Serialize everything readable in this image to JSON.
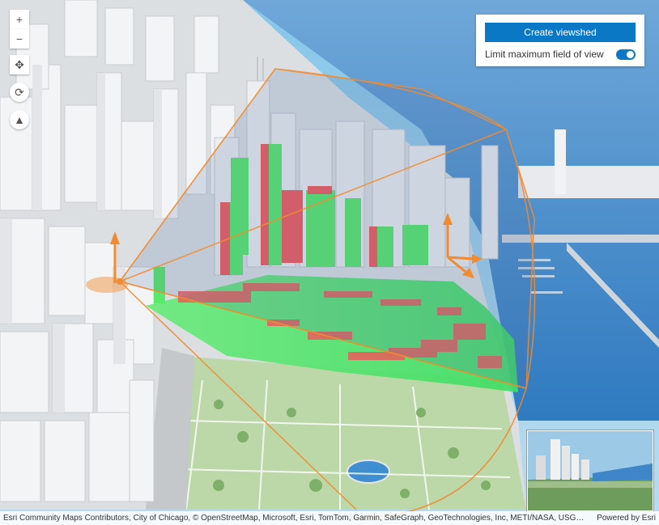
{
  "navigation": {
    "zoom_in_label": "+",
    "zoom_out_label": "−",
    "pan_glyph": "✥",
    "rotate_glyph": "⟳",
    "compass_glyph": "▲"
  },
  "panel": {
    "create_viewshed_label": "Create viewshed",
    "limit_fov_label": "Limit maximum field of view",
    "limit_fov_enabled": true
  },
  "attribution": {
    "text": "Esri Community Maps Contributors, City of Chicago, © OpenStreetMap, Microsoft, Esri, TomTom, Garmin, SafeGraph, GeoTechnologies, Inc, METI/NASA, USGS, EPA, NPS, US ...",
    "powered_by": "Powered by Esri"
  },
  "colors": {
    "water": "#3e86c6",
    "sky": "#8ec8e8",
    "visible": "#4be36a",
    "obstructed": "#f25b5b",
    "frustum": "#f28a2e",
    "accent": "#0b78c6"
  }
}
